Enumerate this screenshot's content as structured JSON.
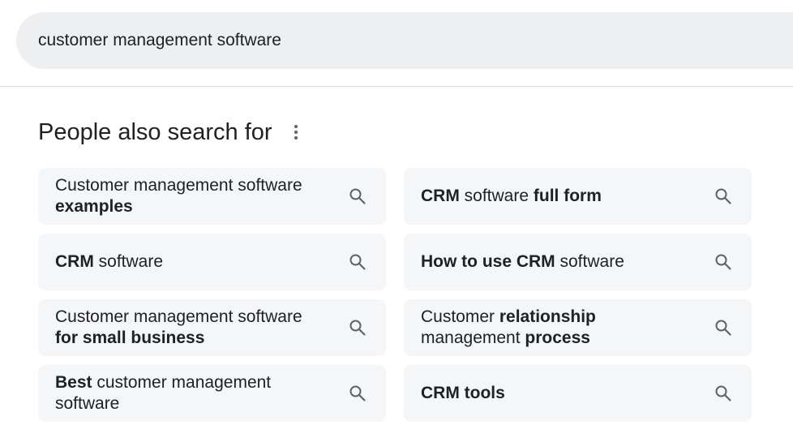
{
  "search": {
    "query": "customer management software"
  },
  "section": {
    "title": "People also search for",
    "more_icon": "more-vert-icon"
  },
  "suggestions": [
    {
      "p0": "Customer management software ",
      "b0": "examples",
      "p1": "",
      "b1": "",
      "p2": "",
      "b2": "",
      "p3": ""
    },
    {
      "p0": "",
      "b0": "CRM",
      "p1": " software ",
      "b1": "full form",
      "p2": "",
      "b2": "",
      "p3": ""
    },
    {
      "p0": "",
      "b0": "CRM",
      "p1": " software",
      "b1": "",
      "p2": "",
      "b2": "",
      "p3": ""
    },
    {
      "p0": "",
      "b0": "How to use CRM",
      "p1": " software",
      "b1": "",
      "p2": "",
      "b2": "",
      "p3": ""
    },
    {
      "p0": "Customer management software ",
      "b0": "for small business",
      "p1": "",
      "b1": "",
      "p2": "",
      "b2": "",
      "p3": ""
    },
    {
      "p0": "Customer ",
      "b0": "relationship",
      "p1": " management ",
      "b1": "process",
      "p2": "",
      "b2": "",
      "p3": ""
    },
    {
      "p0": "",
      "b0": "Best",
      "p1": " customer management software",
      "b1": "",
      "p2": "",
      "b2": "",
      "p3": ""
    },
    {
      "p0": "",
      "b0": "CRM tools",
      "p1": "",
      "b1": "",
      "p2": "",
      "b2": "",
      "p3": ""
    }
  ],
  "icons": {
    "chip_icon": "search-icon"
  },
  "colors": {
    "search_bar_bg": "#edeff1",
    "chip_bg": "#f5f6f7",
    "text": "#202124",
    "icon": "#5f6368"
  }
}
